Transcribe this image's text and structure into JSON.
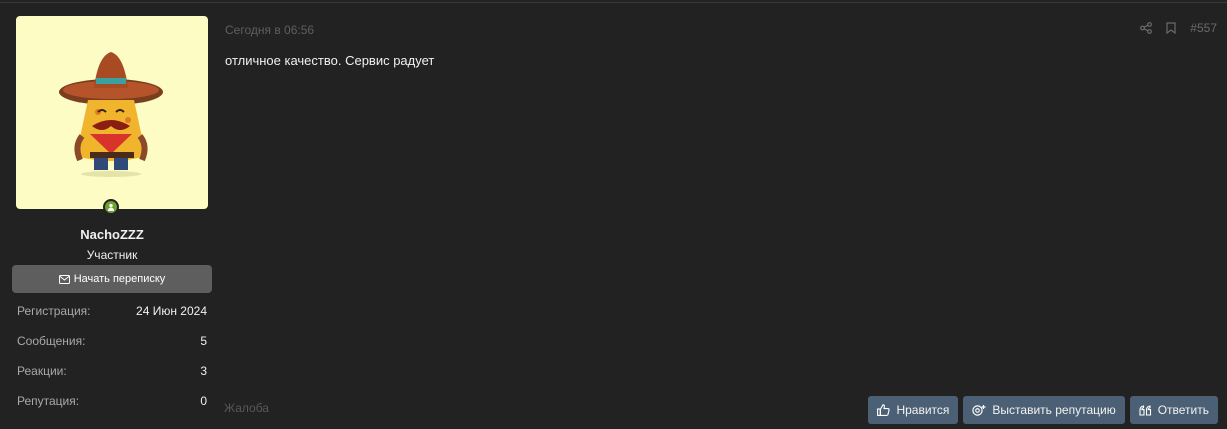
{
  "user": {
    "name": "NachoZZZ",
    "title": "Участник",
    "avatar_icon": "sombrero-nacho-avatar",
    "online": true
  },
  "start_conversation_label": "Начать переписку",
  "stats": [
    {
      "label": "Регистрация:",
      "value": "24 Июн 2024"
    },
    {
      "label": "Сообщения:",
      "value": "5"
    },
    {
      "label": "Реакции:",
      "value": "3"
    },
    {
      "label": "Репутация:",
      "value": "0"
    }
  ],
  "post": {
    "date": "Сегодня в 06:56",
    "number": "#557",
    "text": "отличное качество. Сервис радует",
    "report_label": "Жалоба"
  },
  "actions": {
    "like_label": "Нравится",
    "reputation_label": "Выставить репутацию",
    "reply_label": "Ответить"
  },
  "colors": {
    "background": "#222222",
    "button": "#4b6075",
    "online": "#6ca32e"
  }
}
